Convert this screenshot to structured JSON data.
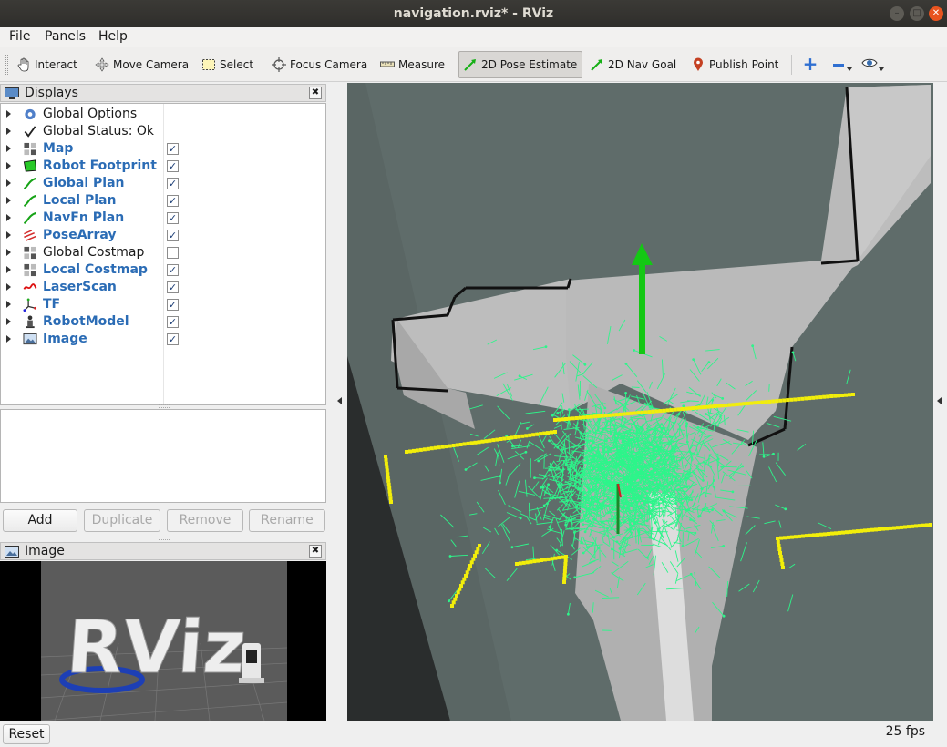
{
  "window": {
    "title": "navigation.rviz* - RViz"
  },
  "menu": {
    "items": [
      {
        "label": "File"
      },
      {
        "label": "Panels"
      },
      {
        "label": "Help"
      }
    ]
  },
  "toolbar": {
    "tools": [
      {
        "label": "Interact",
        "icon": "hand-icon"
      },
      {
        "label": "Move Camera",
        "icon": "move-camera-icon"
      },
      {
        "label": "Select",
        "icon": "select-icon"
      },
      {
        "label": "Focus Camera",
        "icon": "focus-camera-icon"
      },
      {
        "label": "Measure",
        "icon": "measure-icon"
      },
      {
        "label": "2D Pose Estimate",
        "icon": "pose-estimate-icon",
        "active": true
      },
      {
        "label": "2D Nav Goal",
        "icon": "nav-goal-icon"
      },
      {
        "label": "Publish Point",
        "icon": "publish-point-icon"
      }
    ]
  },
  "displays": {
    "title": "Displays",
    "items": [
      {
        "label": "Global Options",
        "icon": "gear-icon",
        "checked": null,
        "highlight": false
      },
      {
        "label": "Global Status: Ok",
        "icon": "checkmark-icon",
        "checked": null,
        "highlight": false
      },
      {
        "label": "Map",
        "icon": "map-icon",
        "checked": true,
        "highlight": true
      },
      {
        "label": "Robot Footprint",
        "icon": "polygon-icon",
        "checked": true,
        "highlight": true
      },
      {
        "label": "Global Plan",
        "icon": "path-icon",
        "checked": true,
        "highlight": true
      },
      {
        "label": "Local Plan",
        "icon": "path-icon",
        "checked": true,
        "highlight": true
      },
      {
        "label": "NavFn Plan",
        "icon": "path-icon",
        "checked": true,
        "highlight": true
      },
      {
        "label": "PoseArray",
        "icon": "pose-array-icon",
        "checked": true,
        "highlight": true
      },
      {
        "label": "Global Costmap",
        "icon": "map-icon",
        "checked": false,
        "highlight": false
      },
      {
        "label": "Local Costmap",
        "icon": "map-icon",
        "checked": true,
        "highlight": true
      },
      {
        "label": "LaserScan",
        "icon": "laser-scan-icon",
        "checked": true,
        "highlight": true
      },
      {
        "label": "TF",
        "icon": "tf-icon",
        "checked": true,
        "highlight": true
      },
      {
        "label": "RobotModel",
        "icon": "robot-icon",
        "checked": true,
        "highlight": true
      },
      {
        "label": "Image",
        "icon": "image-icon",
        "checked": true,
        "highlight": true
      }
    ],
    "buttons": {
      "add": "Add",
      "duplicate": "Duplicate",
      "remove": "Remove",
      "rename": "Rename"
    }
  },
  "image_panel": {
    "title": "Image",
    "logo_text": "RViz"
  },
  "status": {
    "reset_label": "Reset",
    "fps": "25 fps"
  },
  "colors": {
    "accent_blue": "#2b6cb5",
    "particles": "#2df58a",
    "scan": "#f2ee0a",
    "goal_arrow": "#14c814"
  }
}
